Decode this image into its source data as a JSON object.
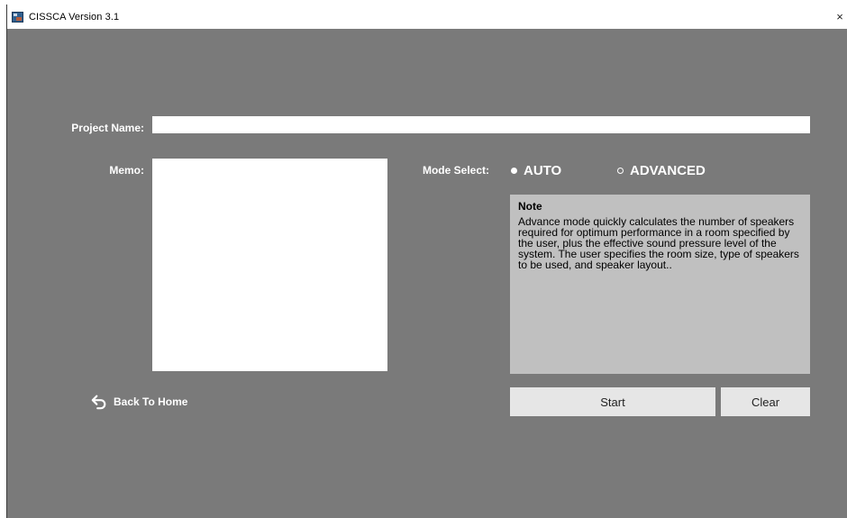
{
  "window": {
    "title": "CISSCA Version 3.1",
    "close_glyph": "×",
    "icon": "app-icon"
  },
  "form": {
    "project_name_label": "Project Name:",
    "project_name_value": "",
    "memo_label": "Memo:",
    "memo_value": "",
    "mode_select_label": "Mode Select:",
    "modes": [
      {
        "label": "AUTO",
        "selected": true
      },
      {
        "label": "ADVANCED",
        "selected": false
      }
    ]
  },
  "note": {
    "title": "Note",
    "text": "Advance mode quickly calculates the number of speakers required for optimum performance in a room specified by the user, plus the effective sound pressure level of the system. The user specifies the room size, type of speakers to be used, and speaker layout.."
  },
  "actions": {
    "back_label": "Back To Home",
    "back_icon": "undo-arrow-icon",
    "start_label": "Start",
    "clear_label": "Clear"
  },
  "colors": {
    "background": "#7a7a7a",
    "note_bg": "#c0c0c0",
    "button_bg": "#e6e6e6"
  }
}
